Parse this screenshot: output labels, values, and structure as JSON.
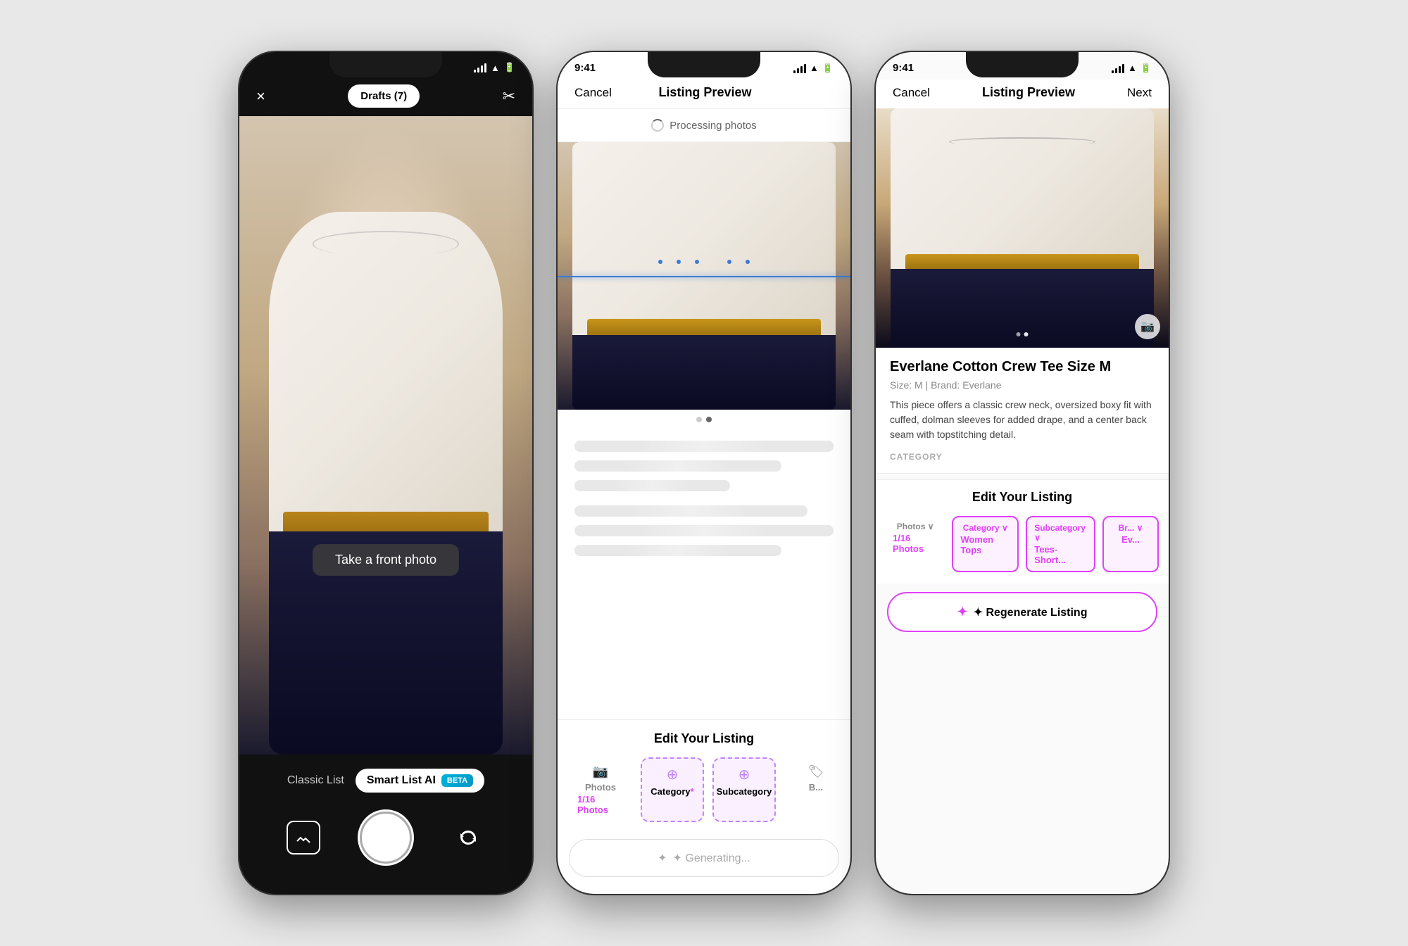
{
  "phone1": {
    "header": {
      "close_label": "×",
      "drafts_label": "Drafts (7)",
      "scissors_label": "✂"
    },
    "camera": {
      "photo_prompt": "Take a front photo",
      "mode_classic": "Classic List",
      "mode_smart": "Smart List AI",
      "mode_beta": "BETA"
    },
    "controls": {
      "gallery_icon": "gallery-icon",
      "shutter_icon": "shutter-icon",
      "flip_icon": "flip-icon"
    }
  },
  "phone2": {
    "status": {
      "time": "9:41",
      "signal": "●●●",
      "wifi": "wifi",
      "battery": "battery"
    },
    "nav": {
      "cancel": "Cancel",
      "title": "Listing Preview",
      "next": ""
    },
    "processing": {
      "label": "Processing photos"
    },
    "skeleton": {
      "lines": [
        "full",
        "80",
        "60",
        "90",
        "70"
      ]
    },
    "edit": {
      "title": "Edit Your Listing",
      "tabs": [
        {
          "icon": "📷",
          "label": "Photos",
          "value": "1/16 Photos",
          "selected": false
        },
        {
          "icon": "⊕",
          "label": "Category",
          "req": "*",
          "selected": true
        },
        {
          "icon": "⊕",
          "label": "Subcategory",
          "selected": true
        },
        {
          "icon": "B",
          "label": "Br...",
          "selected": false
        }
      ]
    },
    "generating": "✦ Generating..."
  },
  "phone3": {
    "status": {
      "time": "9:41",
      "signal": "●●●",
      "wifi": "wifi",
      "battery": "battery"
    },
    "nav": {
      "cancel": "Cancel",
      "title": "Listing Preview",
      "next": "Next"
    },
    "listing": {
      "title": "Everlane Cotton Crew Tee Size M",
      "meta": "Size: M  |  Brand: Everlane",
      "description": "This piece offers a classic crew neck, oversized boxy fit with cuffed, dolman sleeves for added drape, and a center back seam with topstitching detail.",
      "category_label": "CATEGORY"
    },
    "edit": {
      "title": "Edit Your Listing",
      "tabs": [
        {
          "label": "Photos",
          "value": "1/16 Photos"
        },
        {
          "label": "Category",
          "value": "Women Tops",
          "active": true
        },
        {
          "label": "Subcategory",
          "value": "Tees- Short...",
          "active": true
        },
        {
          "label": "Br...",
          "value": "Ev...",
          "active": true
        }
      ]
    },
    "regen_label": "✦ Regenerate Listing"
  }
}
